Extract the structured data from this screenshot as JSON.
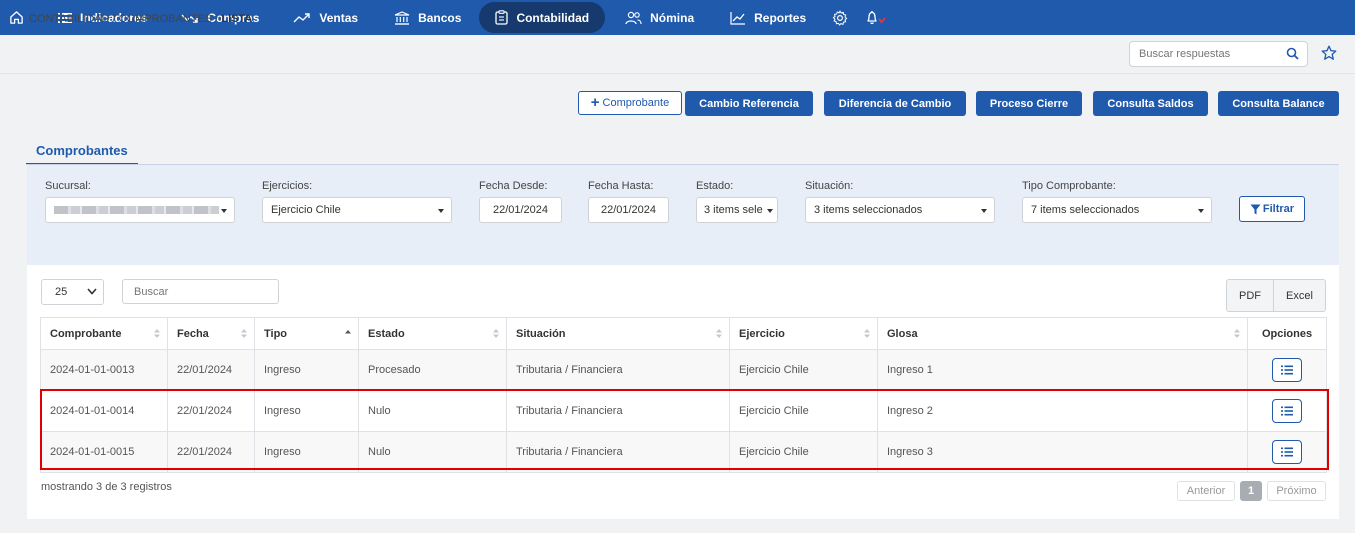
{
  "nav": {
    "items": [
      {
        "label": "Indicadores",
        "icon": "list-icon"
      },
      {
        "label": "Compras",
        "icon": "trend-down-icon"
      },
      {
        "label": "Ventas",
        "icon": "trend-up-icon"
      },
      {
        "label": "Bancos",
        "icon": "bank-icon"
      },
      {
        "label": "Contabilidad",
        "icon": "clipboard-icon"
      },
      {
        "label": "Nómina",
        "icon": "users-icon"
      },
      {
        "label": "Reportes",
        "icon": "chart-icon"
      }
    ],
    "active": "Contabilidad"
  },
  "breadcrumb": {
    "part1": "CONTABILIDAD",
    "sep": " / ",
    "part2": "COMPROBANTES",
    "current": "LISTA"
  },
  "search": {
    "placeholder": "Buscar respuestas"
  },
  "actions": {
    "add": "Comprobante",
    "cambio_referencia": "Cambio Referencia",
    "diferencia_cambio": "Diferencia de Cambio",
    "proceso_cierre": "Proceso Cierre",
    "consulta_saldos": "Consulta Saldos",
    "consulta_balance": "Consulta Balance"
  },
  "tab": "Comprobantes",
  "filters": {
    "sucursal": {
      "label": "Sucursal:"
    },
    "ejercicios": {
      "label": "Ejercicios:",
      "value": "Ejercicio Chile"
    },
    "fecha_desde": {
      "label": "Fecha Desde:",
      "value": "22/01/2024"
    },
    "fecha_hasta": {
      "label": "Fecha Hasta:",
      "value": "22/01/2024"
    },
    "estado": {
      "label": "Estado:",
      "value": "3 items sele"
    },
    "situacion": {
      "label": "Situación:",
      "value": "3 items seleccionados"
    },
    "tipo": {
      "label": "Tipo Comprobante:",
      "value": "7 items seleccionados"
    },
    "button": "Filtrar"
  },
  "table_controls": {
    "page_size": "25",
    "search_placeholder": "Buscar",
    "pdf": "PDF",
    "excel": "Excel"
  },
  "columns": [
    "Comprobante",
    "Fecha",
    "Tipo",
    "Estado",
    "Situación",
    "Ejercicio",
    "Glosa",
    "Opciones"
  ],
  "rows": [
    {
      "comprobante": "2024-01-01-0013",
      "fecha": "22/01/2024",
      "tipo": "Ingreso",
      "estado": "Procesado",
      "situacion": "Tributaria / Financiera",
      "ejercicio": "Ejercicio Chile",
      "glosa": "Ingreso 1"
    },
    {
      "comprobante": "2024-01-01-0014",
      "fecha": "22/01/2024",
      "tipo": "Ingreso",
      "estado": "Nulo",
      "situacion": "Tributaria / Financiera",
      "ejercicio": "Ejercicio Chile",
      "glosa": "Ingreso 2"
    },
    {
      "comprobante": "2024-01-01-0015",
      "fecha": "22/01/2024",
      "tipo": "Ingreso",
      "estado": "Nulo",
      "situacion": "Tributaria / Financiera",
      "ejercicio": "Ejercicio Chile",
      "glosa": "Ingreso 3"
    }
  ],
  "footer": {
    "info": "mostrando 3 de 3 registros",
    "prev": "Anterior",
    "page": "1",
    "next": "Próximo"
  },
  "colors": {
    "primary": "#1f5aad",
    "nav_active": "#16396e",
    "highlight": "#e00000",
    "bell_badge": "#e8333a"
  }
}
